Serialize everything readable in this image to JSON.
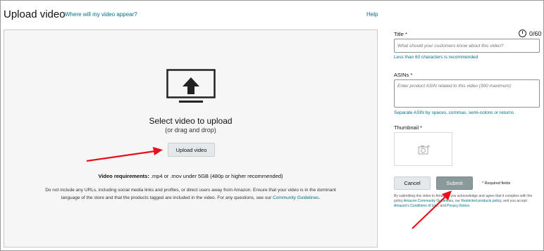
{
  "header": {
    "title": "Upload video",
    "where_link": "Where will my video appear?",
    "help_link": "Help"
  },
  "upload": {
    "select_text": "Select video to upload",
    "drag_text": "(or drag and drop)",
    "button_label": "Upload video",
    "requirements_label": "Video requirements:",
    "requirements_value": ".mp4 or .mov under 5GB (480p or higher recommended)",
    "note_line1": "Do not include any URLs, including social media links and profiles, or direct users away from Amazon. Ensure that your video is in the dominant",
    "note_line2": "language of the store and that the products tagged are included in the video. For any questions, see our",
    "guidelines_link": "Community Guidelines",
    "note_end": "."
  },
  "form": {
    "title_label": "Title *",
    "title_counter": "0/60",
    "title_placeholder": "What should your customers know about this video?",
    "title_hint": "Less than 60 characters is recommended",
    "asin_label": "ASINs *",
    "asin_placeholder": "Enter product ASIN related to this video (300 maximum)",
    "asin_hint": "Separate ASIN by spaces, commas, semi-colons or returns",
    "thumbnail_label": "Thumbnail *",
    "thumbnail_icon": "camera-add-icon",
    "cancel_label": "Cancel",
    "submit_label": "Submit",
    "required_note": "* Required fields"
  },
  "legal": {
    "text1": "By submitting this video to Amazon, you acknowledge and agree that it complies with the policy",
    "link1": "Amazon Community Guidelines",
    "text2": ", our",
    "link2": "Restricted products policy",
    "text3": ", and you accept",
    "link3": "Amazon's Conditions of Use",
    "text4": ", and",
    "link4": "Privacy Notice",
    "text5": "."
  },
  "colors": {
    "link": "#007185",
    "annotation_arrow": "#e8101a",
    "submit_bg": "#8a9a9b"
  }
}
